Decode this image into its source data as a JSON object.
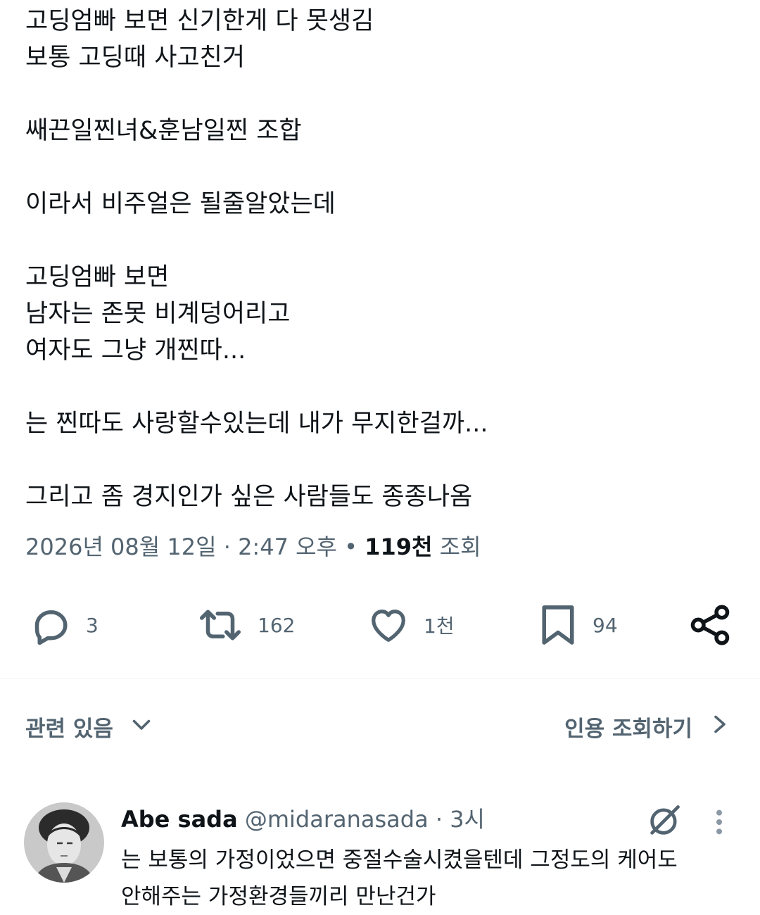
{
  "tweet": {
    "lines": [
      "고딩엄빠 보면 신기한게 다 못생김",
      "보통 고딩때 사고친거",
      "",
      "쌔끈일찐녀&훈남일찐 조합",
      "",
      "이라서 비주얼은 될줄알았는데",
      "",
      "고딩엄빠 보면",
      "남자는 존못 비계덩어리고",
      "여자도 그냥 개찐따...",
      "",
      "는 찐따도 사랑할수있는데 내가 무지한걸까...",
      "",
      "그리고 좀 경지인가 싶은 사람들도 종종나옴"
    ],
    "date": "2026년 08월 12일",
    "sep1": " · ",
    "time": "2:47 오후",
    "sep2": " • ",
    "views_count": "119천",
    "views_label": " 조회"
  },
  "actions": {
    "reply": {
      "icon": "reply-icon",
      "count": "3"
    },
    "retweet": {
      "icon": "retweet-icon",
      "count": "162"
    },
    "like": {
      "icon": "heart-icon",
      "count": "1천"
    },
    "bookmark": {
      "icon": "bookmark-icon",
      "count": "94"
    },
    "share": {
      "icon": "share-icon"
    }
  },
  "related": {
    "label": "관련 있음",
    "icon": "chevron-down-icon"
  },
  "quote_views": {
    "label": "인용 조회하기",
    "icon": "chevron-right-icon"
  },
  "reply": {
    "name": "Abe sada",
    "handle": "@midaranasada",
    "dot": " · ",
    "time": "3시",
    "body": [
      "는 보통의 가정이었으면 중절수술시켰을텐데 그정도의 케어도",
      "안해주는 가정환경들끼리 만난건가"
    ],
    "icons": [
      "grok-icon",
      "more-icon"
    ]
  },
  "colors": {
    "text": "#0f1419",
    "secondary": "#536471",
    "divider": "#eff3f4"
  }
}
